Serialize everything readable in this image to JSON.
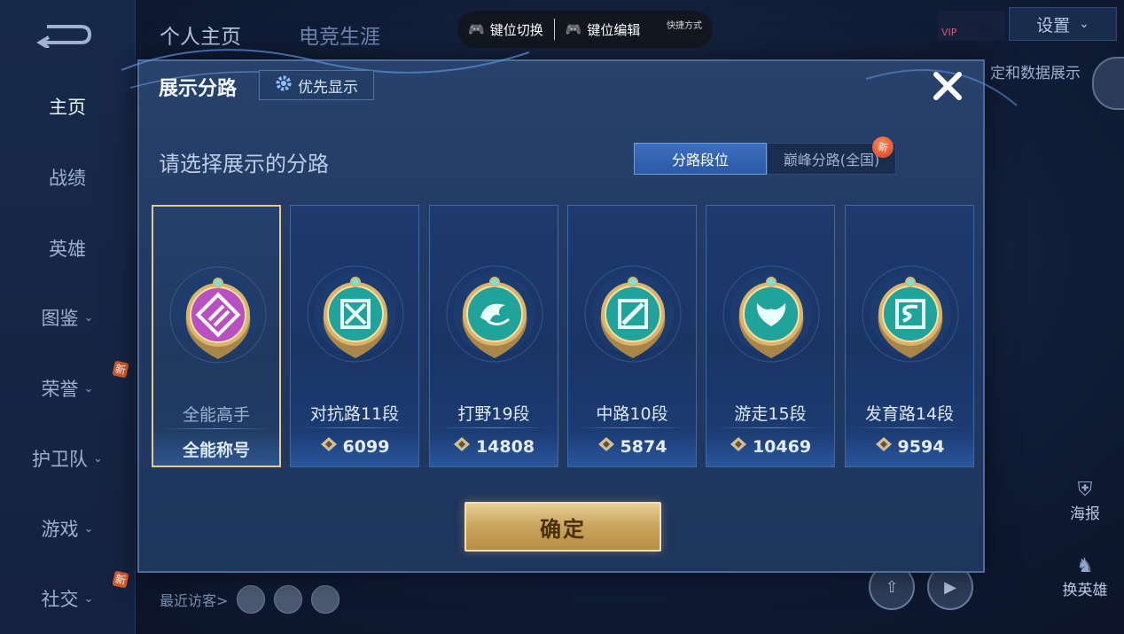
{
  "sidebar": {
    "items": [
      {
        "label": "主页",
        "active": true,
        "chevron": false,
        "new": false
      },
      {
        "label": "战绩",
        "active": false,
        "chevron": false,
        "new": false
      },
      {
        "label": "英雄",
        "active": false,
        "chevron": false,
        "new": false
      },
      {
        "label": "图鉴",
        "active": false,
        "chevron": true,
        "new": false
      },
      {
        "label": "荣誉",
        "active": false,
        "chevron": true,
        "new": true
      },
      {
        "label": "护卫队",
        "active": false,
        "chevron": true,
        "new": false
      },
      {
        "label": "游戏",
        "active": false,
        "chevron": true,
        "new": false
      },
      {
        "label": "社交",
        "active": false,
        "chevron": true,
        "new": true
      }
    ],
    "new_badge": "新"
  },
  "header": {
    "tabs": [
      "个人主页",
      "电竞生涯"
    ],
    "settings_label": "设置",
    "right_text": "定和数据展示"
  },
  "control_bar": {
    "left_label": "键位切换",
    "right_label": "键位编辑",
    "tiny_label": "快捷方式"
  },
  "background": {
    "recent_visitors_label": "最近访客>",
    "poster_label": "海报",
    "change_hero_label": "换英雄"
  },
  "modal": {
    "title": "展示分路",
    "priority_button": "优先显示",
    "prompt": "请选择展示的分路",
    "tabs": [
      {
        "label": "分路段位",
        "active": true
      },
      {
        "label": "巅峰分路(全国)",
        "active": false,
        "badge": "新"
      }
    ],
    "cards": [
      {
        "name": "全能高手",
        "value": "全能称号",
        "selected": true,
        "emblem": "all-round-emblem",
        "emblem_color": "#b94fc2"
      },
      {
        "name": "对抗路11段",
        "value": "6099",
        "selected": false,
        "emblem": "clash-lane-emblem",
        "emblem_color": "#1fa39a"
      },
      {
        "name": "打野19段",
        "value": "14808",
        "selected": false,
        "emblem": "jungle-emblem",
        "emblem_color": "#1fa39a"
      },
      {
        "name": "中路10段",
        "value": "5874",
        "selected": false,
        "emblem": "mid-lane-emblem",
        "emblem_color": "#1fa39a"
      },
      {
        "name": "游走15段",
        "value": "10469",
        "selected": false,
        "emblem": "roam-emblem",
        "emblem_color": "#1fa39a"
      },
      {
        "name": "发育路14段",
        "value": "9594",
        "selected": false,
        "emblem": "farm-lane-emblem",
        "emblem_color": "#1fa39a"
      }
    ],
    "confirm_button": "确定"
  },
  "colors": {
    "gold": "#e8c78b",
    "accent_blue": "#3b6fbf",
    "teal": "#1fa39a",
    "purple": "#b94fc2"
  }
}
